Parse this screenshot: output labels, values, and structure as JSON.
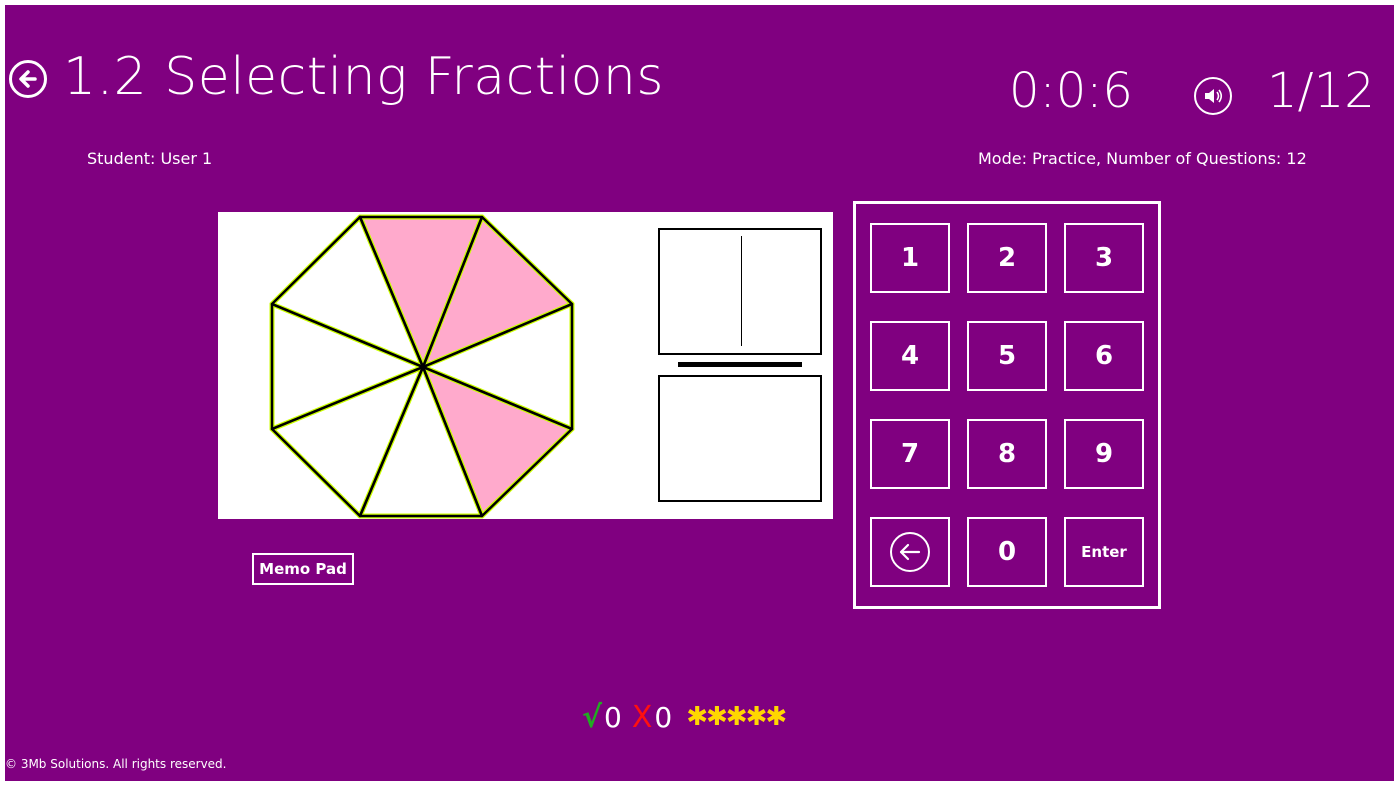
{
  "header": {
    "title": "1.2 Selecting Fractions",
    "timer": "0:0:6",
    "progress": "1/12"
  },
  "info": {
    "student": "Student: User 1",
    "mode": "Mode: Practice, Number of Questions: 12"
  },
  "figure": {
    "shape": "octagon",
    "total_sectors": 8,
    "shaded_sectors": [
      0,
      1,
      3
    ],
    "shaded_color": "#ffaacc",
    "highlight_color": "#ccff00"
  },
  "answer": {
    "numerator": "",
    "denominator": ""
  },
  "memo": {
    "label": "Memo Pad"
  },
  "keypad": {
    "keys": [
      "1",
      "2",
      "3",
      "4",
      "5",
      "6",
      "7",
      "8",
      "9",
      "backspace",
      "0",
      "Enter"
    ]
  },
  "score": {
    "correct": "0",
    "wrong": "0",
    "check_symbol": "√",
    "cross_symbol": "X",
    "stars": "✱✱✱✱✱"
  },
  "footer": {
    "copyright": "© 3Mb Solutions. All rights reserved."
  },
  "colors": {
    "background": "#800080",
    "accent": "#ffffff",
    "star": "#ffd700"
  }
}
